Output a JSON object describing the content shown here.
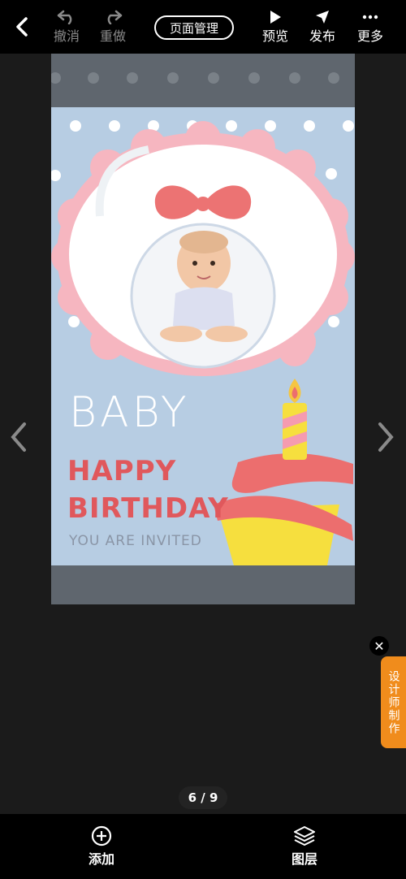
{
  "toolbar": {
    "undo_label": "撤消",
    "redo_label": "重做",
    "page_manager_label": "页面管理",
    "preview_label": "预览",
    "publish_label": "发布",
    "more_label": "更多"
  },
  "card": {
    "heading": "BABY",
    "line1": "HAPPY",
    "line2": "BIRTHDAY",
    "subtext": "YOU ARE INVITED"
  },
  "side_tab": {
    "label": "设计师制作",
    "close_symbol": "✕"
  },
  "pager": {
    "text": "6 / 9"
  },
  "bottom": {
    "add_label": "添加",
    "layers_label": "图层"
  },
  "icons": {
    "back": "chevron-left-icon",
    "undo": "undo-icon",
    "redo": "redo-icon",
    "preview": "play-icon",
    "publish": "send-icon",
    "more": "more-dots-icon",
    "add": "plus-circle-icon",
    "layers": "layers-icon"
  },
  "colors": {
    "card_bg": "#b7cde3",
    "accent_red": "#e0585c",
    "tab_orange": "#f08c1c",
    "bar_black": "#000000"
  }
}
